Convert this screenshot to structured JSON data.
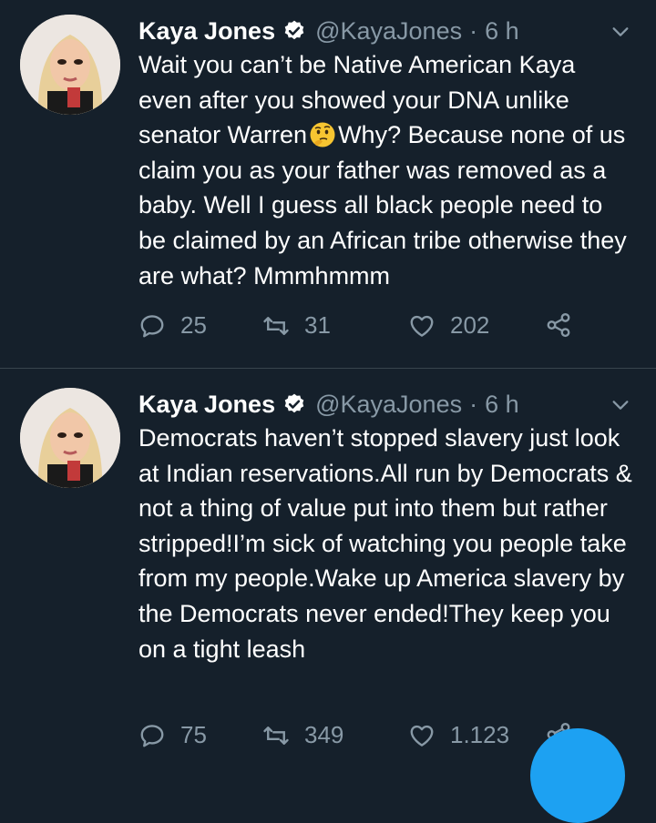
{
  "tweets": [
    {
      "name": "Kaya Jones",
      "handle": "@KayaJones",
      "separator": "·",
      "time": "6 h",
      "text_before_emoji": "Wait you can’t be Native American Kaya even after you showed your DNA unlike senator Warren",
      "emoji": "thinking-face-emoji",
      "text_after_emoji": "Why? Because none of us claim you as your father was removed as a baby. Well I guess all black people need to be claimed by an African tribe otherwise they are what? Mmmhmmm",
      "replies": "25",
      "retweets": "31",
      "likes": "202"
    },
    {
      "name": "Kaya Jones",
      "handle": "@KayaJones",
      "separator": "·",
      "time": "6 h",
      "text": "Democrats haven’t stopped slavery just look at Indian reservations.All run by Democrats & not a thing of value put into them but rather stripped!I’m sick of watching you people take from my people.Wake up America slavery by the Democrats never ended!They keep you on a tight leash",
      "replies": "75",
      "retweets": "349",
      "likes": "1.123"
    }
  ],
  "icons": {
    "reply": "reply-icon",
    "retweet": "retweet-icon",
    "like": "heart-icon",
    "share": "share-icon",
    "verified": "verified-badge-icon",
    "chevron": "chevron-down-icon"
  },
  "colors": {
    "background": "#15202b",
    "text": "#ffffff",
    "secondary": "#8899a6",
    "divider": "#38444d",
    "accent": "#1da1f2"
  }
}
